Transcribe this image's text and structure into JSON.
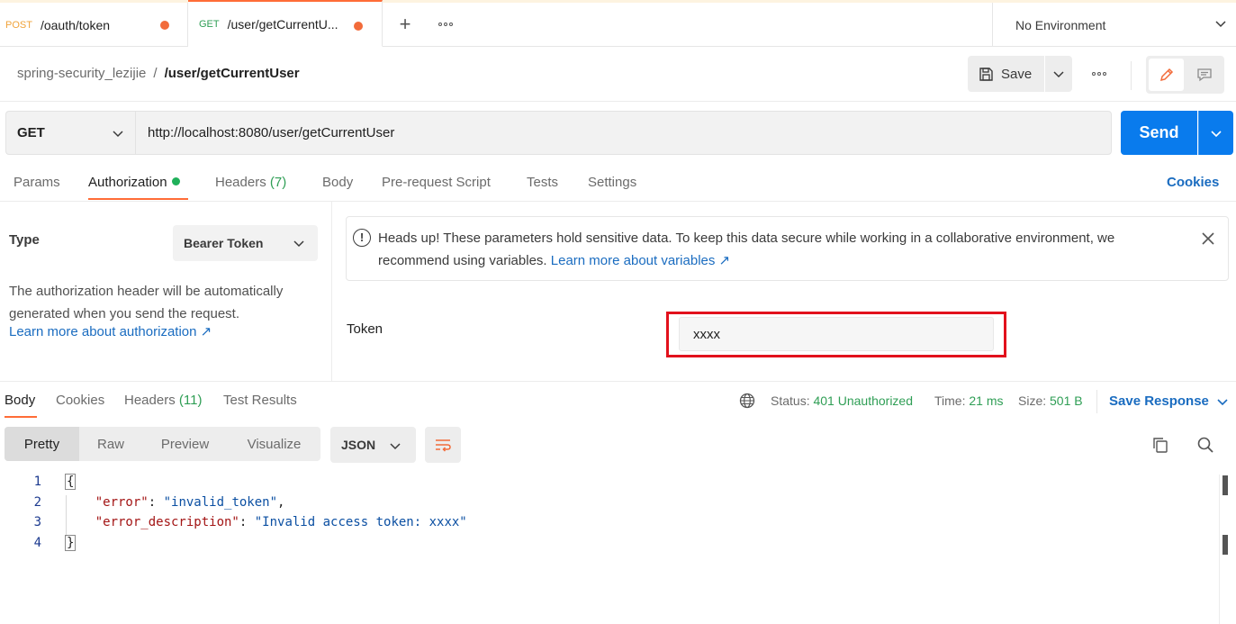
{
  "tabs": [
    {
      "method": "POST",
      "path": "/oauth/token"
    },
    {
      "method": "GET",
      "path": "/user/getCurrentU..."
    }
  ],
  "environment": "No Environment",
  "breadcrumb": {
    "collection": "spring-security_lezijie",
    "separator": "/",
    "request": "/user/getCurrentUser"
  },
  "toolbar": {
    "save_label": "Save"
  },
  "request": {
    "method": "GET",
    "url": "http://localhost:8080/user/getCurrentUser",
    "send_label": "Send"
  },
  "request_tabs": [
    {
      "label": "Params"
    },
    {
      "label": "Authorization"
    },
    {
      "label": "Headers",
      "count": "(7)"
    },
    {
      "label": "Body"
    },
    {
      "label": "Pre-request Script"
    },
    {
      "label": "Tests"
    },
    {
      "label": "Settings"
    }
  ],
  "cookies_label": "Cookies",
  "auth": {
    "type_label": "Type",
    "type_value": "Bearer Token",
    "description": "The authorization header will be automatically generated when you send the request.",
    "learn_more": "Learn more about authorization ↗",
    "notice_text": "Heads up! These parameters hold sensitive data. To keep this data secure while working in a collaborative environment, we recommend using variables.",
    "notice_link": "Learn more about variables ↗",
    "token_label": "Token",
    "token_value": "xxxx"
  },
  "response_tabs": [
    {
      "label": "Body"
    },
    {
      "label": "Cookies"
    },
    {
      "label": "Headers",
      "count": "(11)"
    },
    {
      "label": "Test Results"
    }
  ],
  "response_status": {
    "status_label": "Status:",
    "status_value": "401 Unauthorized",
    "time_label": "Time:",
    "time_value": "21 ms",
    "size_label": "Size:",
    "size_value": "501 B",
    "save_response": "Save Response"
  },
  "view_modes": [
    "Pretty",
    "Raw",
    "Preview",
    "Visualize"
  ],
  "format": "JSON",
  "code_lines": [
    {
      "num": "1",
      "open": "{"
    },
    {
      "num": "2",
      "key": "\"error\"",
      "value": "\"invalid_token\"",
      "trail": ","
    },
    {
      "num": "3",
      "key": "\"error_description\"",
      "value": "\"Invalid access token: xxxx\"",
      "trail": ""
    },
    {
      "num": "4",
      "open": "}"
    }
  ],
  "colors": {
    "accent": "#ff6c37",
    "send": "#097bed",
    "link": "#1a6cc0",
    "success": "#2f9e55",
    "highlight": "#e2111c"
  }
}
